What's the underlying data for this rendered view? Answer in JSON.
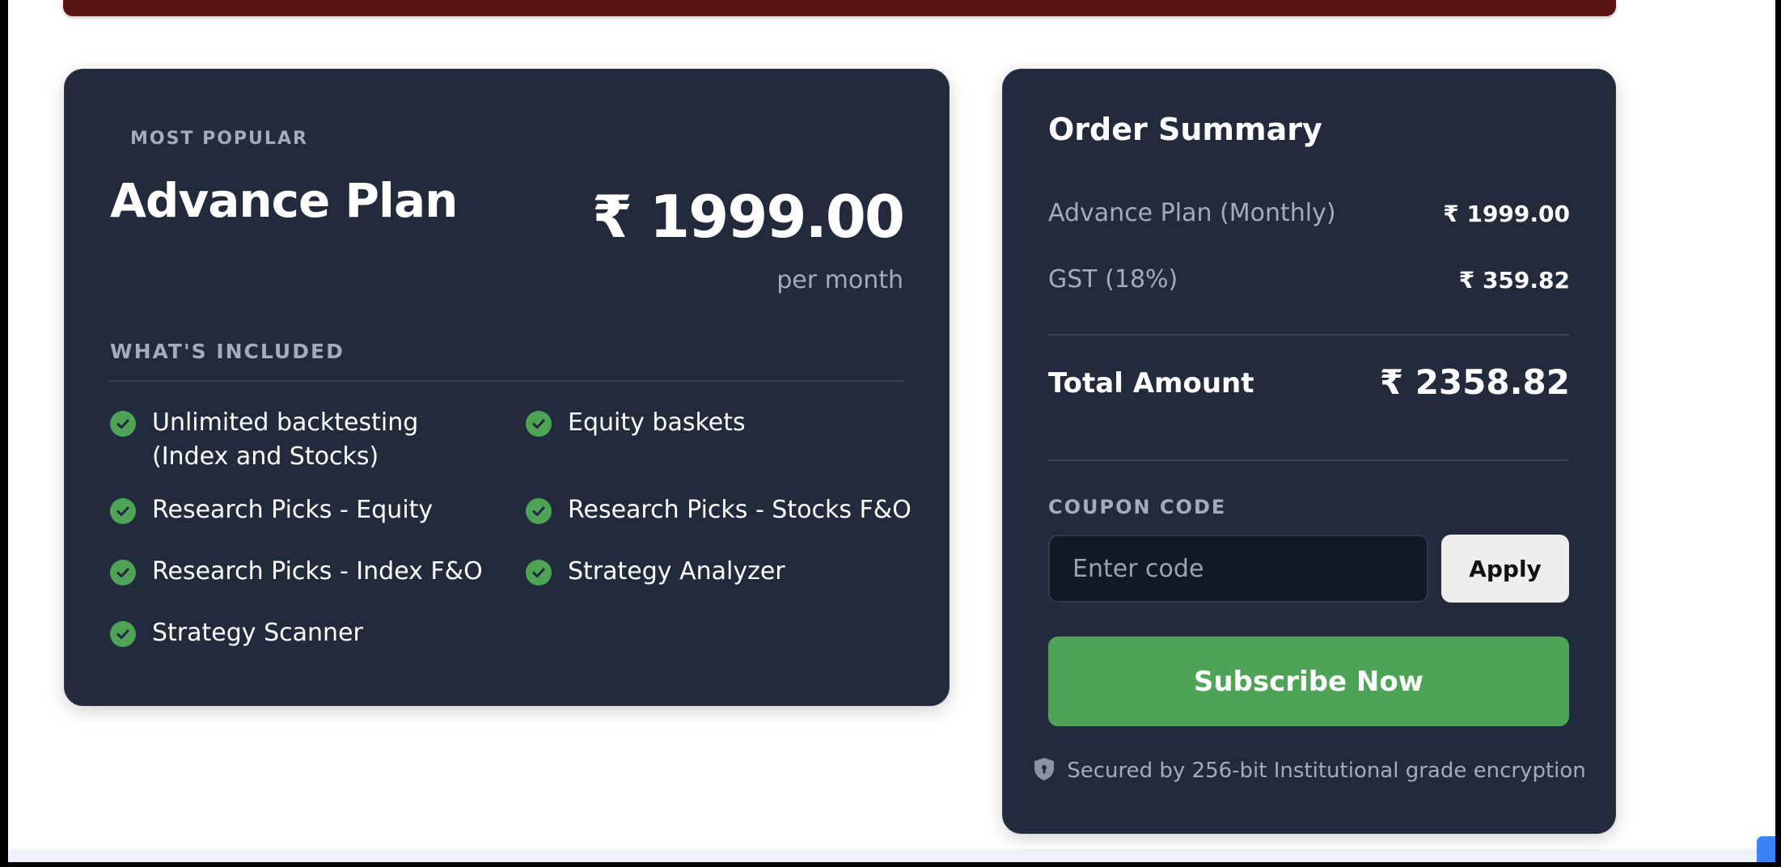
{
  "plan_card": {
    "eyebrow": "MOST POPULAR",
    "plan_name": "Advance Plan",
    "price": "₹ 1999.00",
    "period": "per month",
    "included_title": "WHAT'S INCLUDED",
    "features": [
      {
        "label": "Unlimited backtesting\n(Index and Stocks)",
        "icon": "check-icon"
      },
      {
        "label": "Equity baskets",
        "icon": "check-icon"
      },
      {
        "label": "Research Picks - Equity",
        "icon": "check-icon"
      },
      {
        "label": "Research Picks - Stocks F&O",
        "icon": "check-icon"
      },
      {
        "label": "Research Picks - Index F&O",
        "icon": "check-icon"
      },
      {
        "label": "Strategy Analyzer",
        "icon": "check-icon"
      },
      {
        "label": "Strategy Scanner",
        "icon": "check-icon"
      }
    ]
  },
  "order_summary": {
    "title": "Order Summary",
    "rows": [
      {
        "label": "Advance Plan (Monthly)",
        "value": "₹ 1999.00"
      },
      {
        "label": "GST (18%)",
        "value": "₹ 359.82"
      }
    ],
    "total_label": "Total Amount",
    "total_value": "₹ 2358.82",
    "coupon_label": "COUPON CODE",
    "coupon_placeholder": "Enter code",
    "coupon_value": "",
    "apply_label": "Apply",
    "subscribe_label": "Subscribe Now",
    "secure_text": "Secured by 256-bit Institutional grade encryption",
    "secure_icon": "shield-icon"
  },
  "colors": {
    "card_bg": "#222b3c",
    "accent_green": "#4ea357",
    "muted_text": "#a3acba",
    "banner": "#5a1414"
  }
}
